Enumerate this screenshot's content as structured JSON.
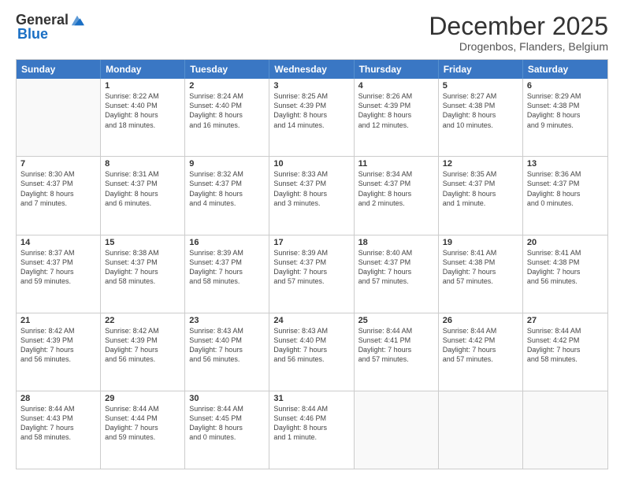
{
  "logo": {
    "general": "General",
    "blue": "Blue"
  },
  "title": "December 2025",
  "subtitle": "Drogenbos, Flanders, Belgium",
  "days": [
    "Sunday",
    "Monday",
    "Tuesday",
    "Wednesday",
    "Thursday",
    "Friday",
    "Saturday"
  ],
  "weeks": [
    [
      {
        "day": "",
        "info": ""
      },
      {
        "day": "1",
        "info": "Sunrise: 8:22 AM\nSunset: 4:40 PM\nDaylight: 8 hours\nand 18 minutes."
      },
      {
        "day": "2",
        "info": "Sunrise: 8:24 AM\nSunset: 4:40 PM\nDaylight: 8 hours\nand 16 minutes."
      },
      {
        "day": "3",
        "info": "Sunrise: 8:25 AM\nSunset: 4:39 PM\nDaylight: 8 hours\nand 14 minutes."
      },
      {
        "day": "4",
        "info": "Sunrise: 8:26 AM\nSunset: 4:39 PM\nDaylight: 8 hours\nand 12 minutes."
      },
      {
        "day": "5",
        "info": "Sunrise: 8:27 AM\nSunset: 4:38 PM\nDaylight: 8 hours\nand 10 minutes."
      },
      {
        "day": "6",
        "info": "Sunrise: 8:29 AM\nSunset: 4:38 PM\nDaylight: 8 hours\nand 9 minutes."
      }
    ],
    [
      {
        "day": "7",
        "info": "Sunrise: 8:30 AM\nSunset: 4:37 PM\nDaylight: 8 hours\nand 7 minutes."
      },
      {
        "day": "8",
        "info": "Sunrise: 8:31 AM\nSunset: 4:37 PM\nDaylight: 8 hours\nand 6 minutes."
      },
      {
        "day": "9",
        "info": "Sunrise: 8:32 AM\nSunset: 4:37 PM\nDaylight: 8 hours\nand 4 minutes."
      },
      {
        "day": "10",
        "info": "Sunrise: 8:33 AM\nSunset: 4:37 PM\nDaylight: 8 hours\nand 3 minutes."
      },
      {
        "day": "11",
        "info": "Sunrise: 8:34 AM\nSunset: 4:37 PM\nDaylight: 8 hours\nand 2 minutes."
      },
      {
        "day": "12",
        "info": "Sunrise: 8:35 AM\nSunset: 4:37 PM\nDaylight: 8 hours\nand 1 minute."
      },
      {
        "day": "13",
        "info": "Sunrise: 8:36 AM\nSunset: 4:37 PM\nDaylight: 8 hours\nand 0 minutes."
      }
    ],
    [
      {
        "day": "14",
        "info": "Sunrise: 8:37 AM\nSunset: 4:37 PM\nDaylight: 7 hours\nand 59 minutes."
      },
      {
        "day": "15",
        "info": "Sunrise: 8:38 AM\nSunset: 4:37 PM\nDaylight: 7 hours\nand 58 minutes."
      },
      {
        "day": "16",
        "info": "Sunrise: 8:39 AM\nSunset: 4:37 PM\nDaylight: 7 hours\nand 58 minutes."
      },
      {
        "day": "17",
        "info": "Sunrise: 8:39 AM\nSunset: 4:37 PM\nDaylight: 7 hours\nand 57 minutes."
      },
      {
        "day": "18",
        "info": "Sunrise: 8:40 AM\nSunset: 4:37 PM\nDaylight: 7 hours\nand 57 minutes."
      },
      {
        "day": "19",
        "info": "Sunrise: 8:41 AM\nSunset: 4:38 PM\nDaylight: 7 hours\nand 57 minutes."
      },
      {
        "day": "20",
        "info": "Sunrise: 8:41 AM\nSunset: 4:38 PM\nDaylight: 7 hours\nand 56 minutes."
      }
    ],
    [
      {
        "day": "21",
        "info": "Sunrise: 8:42 AM\nSunset: 4:39 PM\nDaylight: 7 hours\nand 56 minutes."
      },
      {
        "day": "22",
        "info": "Sunrise: 8:42 AM\nSunset: 4:39 PM\nDaylight: 7 hours\nand 56 minutes."
      },
      {
        "day": "23",
        "info": "Sunrise: 8:43 AM\nSunset: 4:40 PM\nDaylight: 7 hours\nand 56 minutes."
      },
      {
        "day": "24",
        "info": "Sunrise: 8:43 AM\nSunset: 4:40 PM\nDaylight: 7 hours\nand 56 minutes."
      },
      {
        "day": "25",
        "info": "Sunrise: 8:44 AM\nSunset: 4:41 PM\nDaylight: 7 hours\nand 57 minutes."
      },
      {
        "day": "26",
        "info": "Sunrise: 8:44 AM\nSunset: 4:42 PM\nDaylight: 7 hours\nand 57 minutes."
      },
      {
        "day": "27",
        "info": "Sunrise: 8:44 AM\nSunset: 4:42 PM\nDaylight: 7 hours\nand 58 minutes."
      }
    ],
    [
      {
        "day": "28",
        "info": "Sunrise: 8:44 AM\nSunset: 4:43 PM\nDaylight: 7 hours\nand 58 minutes."
      },
      {
        "day": "29",
        "info": "Sunrise: 8:44 AM\nSunset: 4:44 PM\nDaylight: 7 hours\nand 59 minutes."
      },
      {
        "day": "30",
        "info": "Sunrise: 8:44 AM\nSunset: 4:45 PM\nDaylight: 8 hours\nand 0 minutes."
      },
      {
        "day": "31",
        "info": "Sunrise: 8:44 AM\nSunset: 4:46 PM\nDaylight: 8 hours\nand 1 minute."
      },
      {
        "day": "",
        "info": ""
      },
      {
        "day": "",
        "info": ""
      },
      {
        "day": "",
        "info": ""
      }
    ]
  ]
}
